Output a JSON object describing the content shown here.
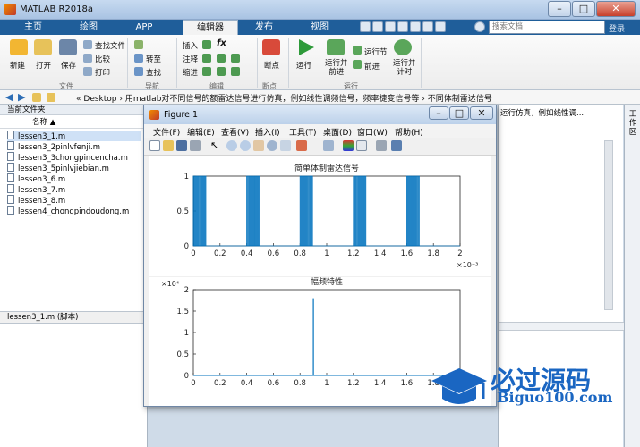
{
  "window": {
    "title": "MATLAB R2018a"
  },
  "tabs": [
    {
      "label": "主页",
      "active": false
    },
    {
      "label": "绘图",
      "active": false
    },
    {
      "label": "APP",
      "active": false
    },
    {
      "label": "编辑器",
      "active": true
    },
    {
      "label": "发布",
      "active": false
    },
    {
      "label": "视图",
      "active": false
    }
  ],
  "search": {
    "placeholder": "搜索文档"
  },
  "login": "登录",
  "ribbon": {
    "file": {
      "new": "新建",
      "open": "打开",
      "save": "保存",
      "find_files": "查找文件",
      "compare": "比较",
      "print": "打印",
      "group": "文件"
    },
    "navigate": {
      "goto": "转至",
      "find": "查找",
      "group": "导航"
    },
    "edit": {
      "insert": "插入",
      "comment": "注释",
      "indent": "缩进",
      "fx": "fx",
      "group": "编辑"
    },
    "breakpoints": {
      "label": "断点",
      "group": "断点"
    },
    "run": {
      "run": "运行",
      "run_advance": "运行并\n前进",
      "run_section": "运行节",
      "advance": "前进",
      "run_time": "运行并\n计时",
      "group": "运行"
    }
  },
  "address": {
    "segments": [
      "«",
      "Desktop",
      "›",
      "用matlab对不同信号的额雷达信号进行仿真，例如线性调频信号，频率捷变信号等",
      "›",
      "不同体制雷达信号"
    ]
  },
  "left_panel": {
    "title": "当前文件夹",
    "column": "名称 ▲",
    "files": [
      "lessen3_1.m",
      "lessen3_2pinlvfenji.m",
      "lessen3_3chongpincencha.m",
      "lessen3_5pinlvjiebian.m",
      "lessen3_6.m",
      "lessen3_7.m",
      "lessen3_8.m",
      "lessen4_chongpindoudong.m"
    ],
    "selected_index": 0,
    "detail": "lessen3_1.m  (脚本)"
  },
  "right_panel": {
    "title": "运行仿真，例如线性调...",
    "workspace": "工作区"
  },
  "figure": {
    "title": "Figure 1",
    "menus": [
      "文件(F)",
      "编辑(E)",
      "查看(V)",
      "插入(I)",
      "工具(T)",
      "桌面(D)",
      "窗口(W)",
      "帮助(H)"
    ],
    "toolbar_icons": [
      "new-figure-icon",
      "open-icon",
      "save-icon",
      "print-icon",
      "pointer-icon",
      "zoom-in-icon",
      "zoom-out-icon",
      "pan-icon",
      "rotate-icon",
      "data-cursor-icon",
      "brush-icon",
      "link-icon",
      "colorbar-icon",
      "legend-icon",
      "hide-tools-icon",
      "show-tools-icon"
    ]
  },
  "chart_data": [
    {
      "type": "line",
      "title": "简单体制雷达信号",
      "xlabel": "",
      "ylabel": "",
      "xlim": [
        0,
        2
      ],
      "ylim": [
        0,
        1
      ],
      "x_exponent": "×10⁻³",
      "x_ticks": [
        "0",
        "0.2",
        "0.4",
        "0.6",
        "0.8",
        "1",
        "1.2",
        "1.4",
        "1.6",
        "1.8",
        "2"
      ],
      "y_ticks": [
        "0",
        "0.5",
        "1"
      ],
      "pulses": [
        {
          "start": 0,
          "end": 0.1
        },
        {
          "start": 0.4,
          "end": 0.5
        },
        {
          "start": 0.8,
          "end": 0.9
        },
        {
          "start": 1.2,
          "end": 1.3
        },
        {
          "start": 1.6,
          "end": 1.7
        }
      ],
      "color": "#0072bd"
    },
    {
      "type": "line",
      "title": "幅频特性",
      "xlabel": "",
      "ylabel": "",
      "xlim": [
        0,
        2
      ],
      "ylim": [
        0,
        20000
      ],
      "y_exponent": "×10⁴",
      "x_ticks": [
        "0",
        "0.2",
        "0.4",
        "0.6",
        "0.8",
        "1",
        "1.2",
        "1.4",
        "1.6",
        "1.8",
        "2"
      ],
      "y_ticks": [
        "0",
        "0.5",
        "1",
        "1.5",
        "2"
      ],
      "peak": {
        "x": 0.9,
        "y": 18000
      },
      "color": "#0072bd"
    }
  ],
  "watermark": {
    "text": "必过源码",
    "url": "Biguo100.com"
  }
}
